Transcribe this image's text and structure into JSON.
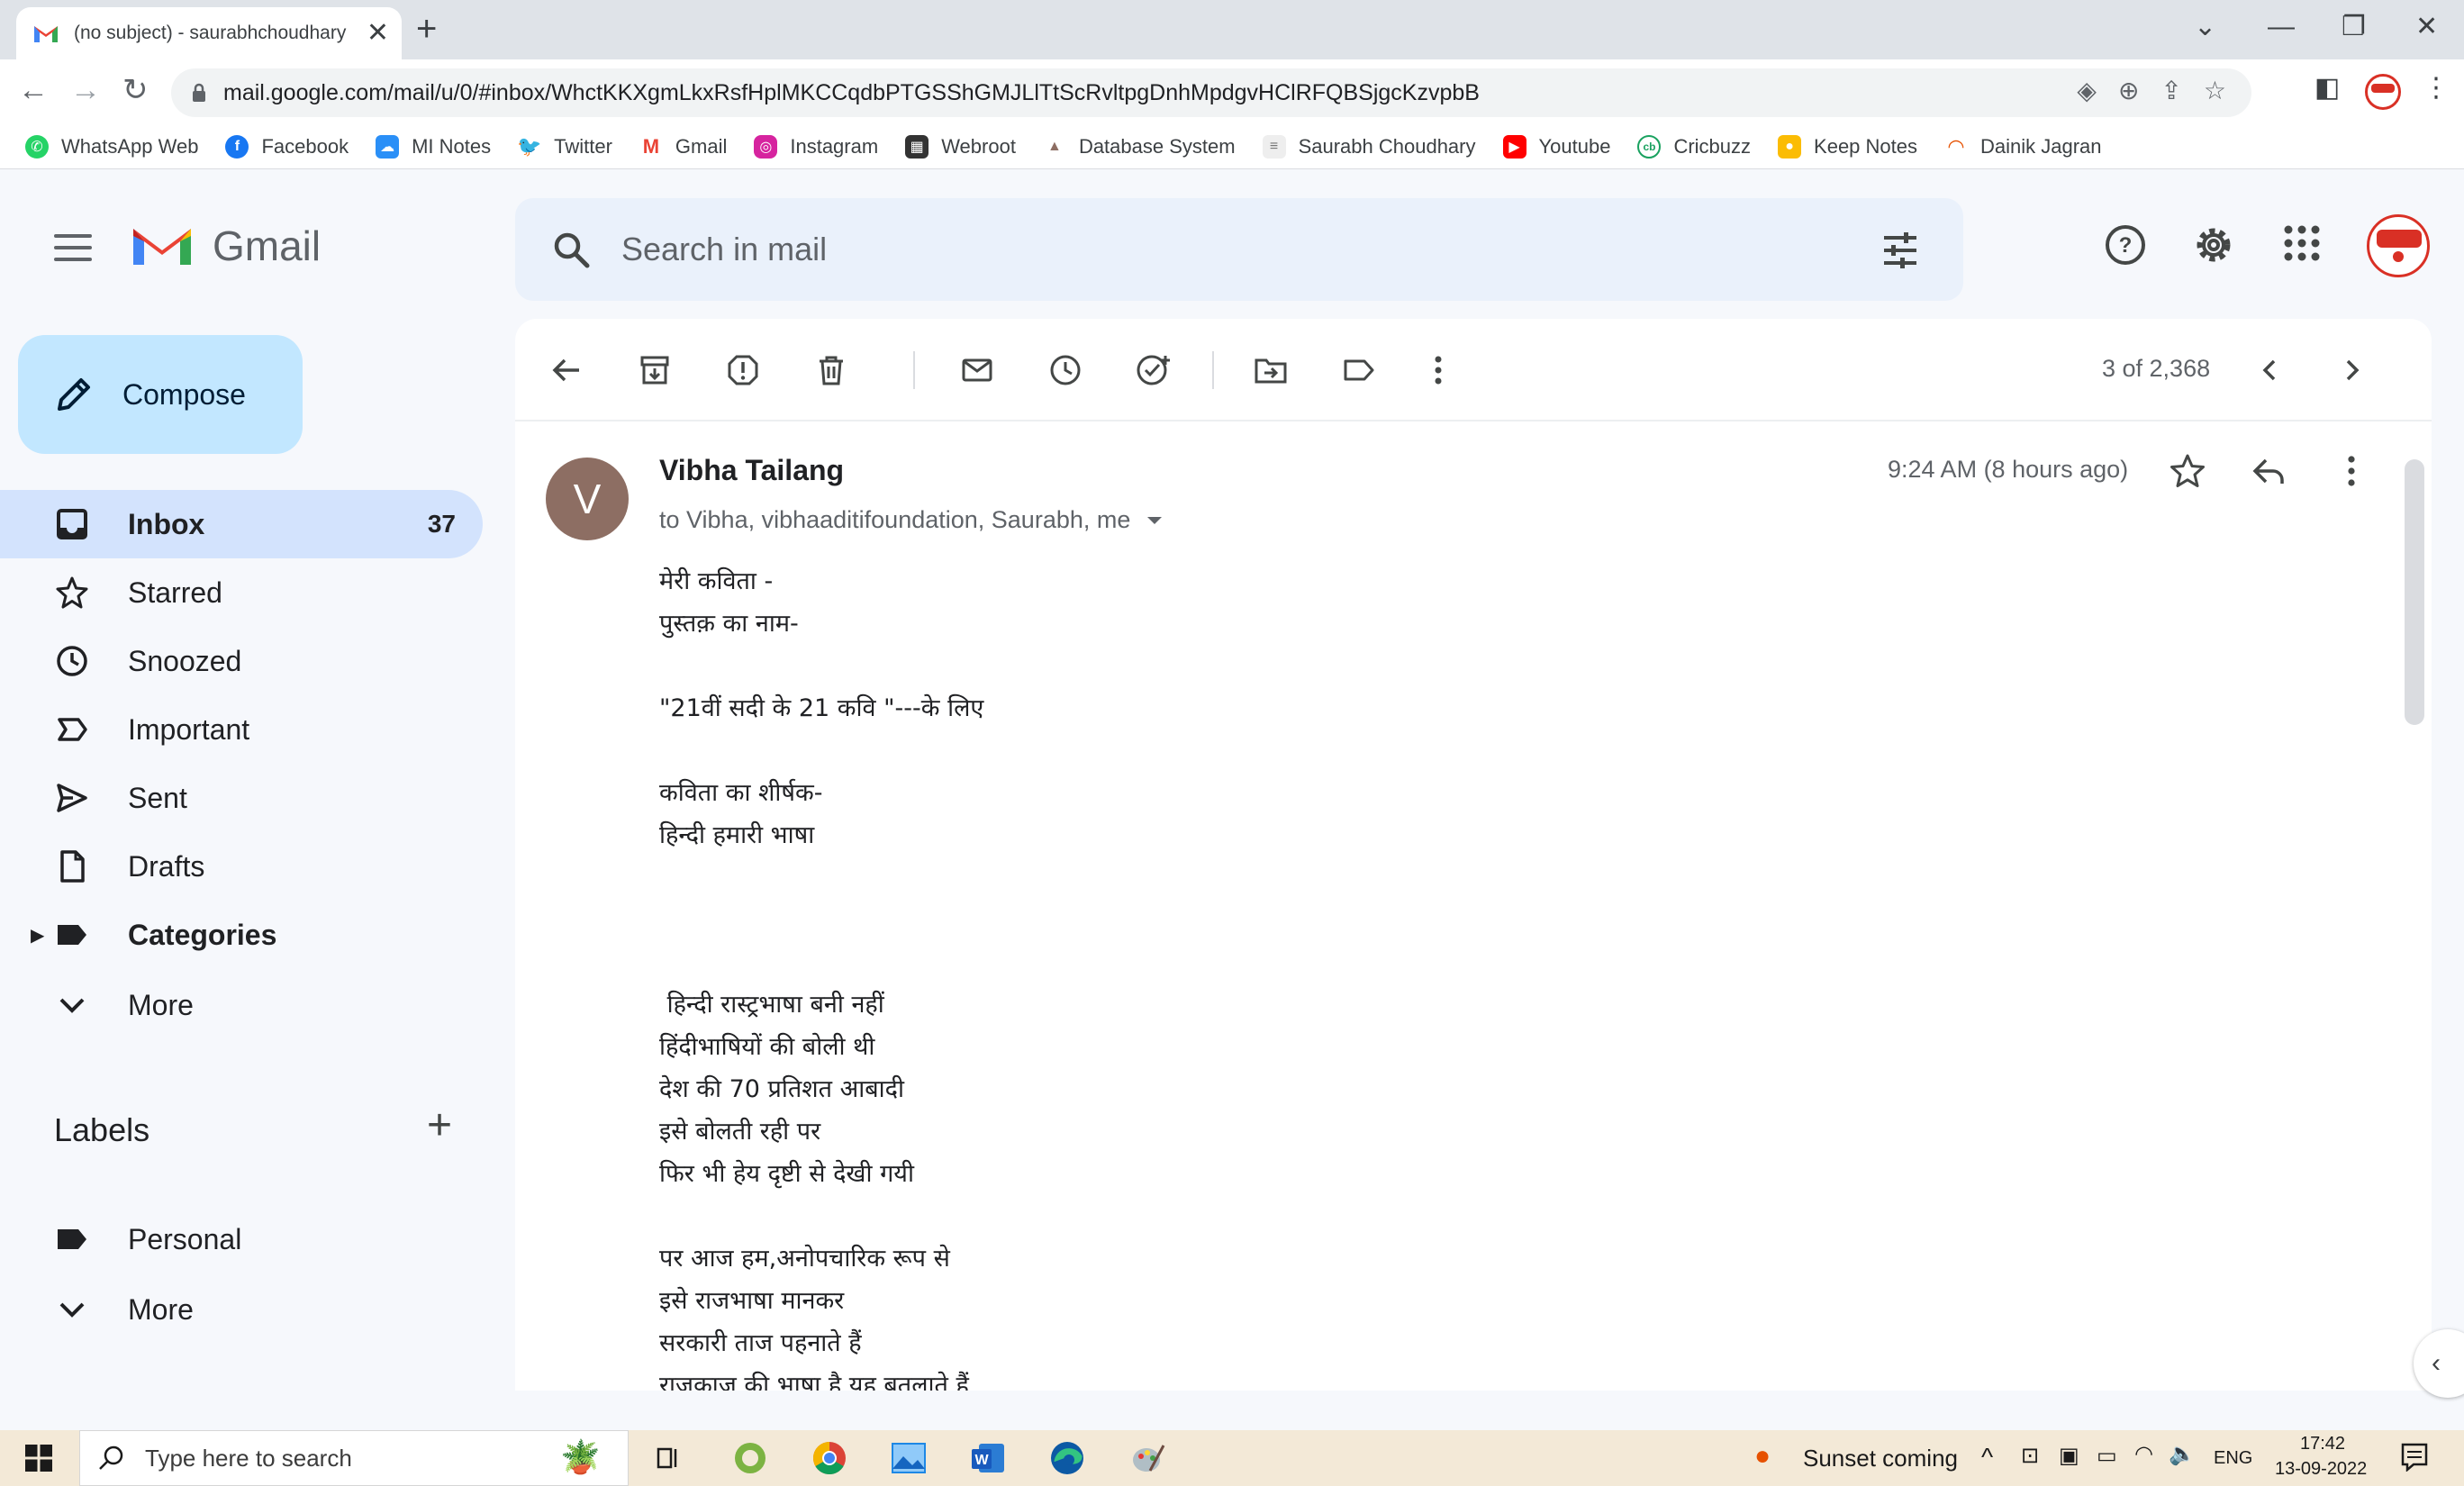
{
  "browser": {
    "tab_title": "(no subject) - saurabhchoudhary",
    "new_tab": "+",
    "url": "mail.google.com/mail/u/0/#inbox/WhctKKXgmLkxRsfHplMKCCqdbPTGSShGMJLlTtScRvltpgDnhMpdgvHClRFQBSjgcKzvpbB",
    "window_controls": {
      "minimize": "—",
      "maximize": "❐",
      "close": "✕",
      "tabsearch": "⌄"
    }
  },
  "bookmarks": [
    {
      "label": "WhatsApp Web",
      "color": "#25d366",
      "glyph": "✆"
    },
    {
      "label": "Facebook",
      "color": "#1877f2",
      "glyph": "f"
    },
    {
      "label": "MI Notes",
      "color": "#2a8ff7",
      "glyph": "☁"
    },
    {
      "label": "Twitter",
      "color": "#1d9bf0",
      "glyph": "t"
    },
    {
      "label": "Gmail",
      "color": "#ea4335",
      "glyph": "M"
    },
    {
      "label": "Instagram",
      "color": "#d6249f",
      "glyph": "◎"
    },
    {
      "label": "Webroot",
      "color": "#333333",
      "glyph": "▦"
    },
    {
      "label": "Database System",
      "color": "#8d6e63",
      "glyph": "▲"
    },
    {
      "label": "Saurabh Choudhary",
      "color": "#9e9e9e",
      "glyph": "≡"
    },
    {
      "label": "Youtube",
      "color": "#ff0000",
      "glyph": "▶"
    },
    {
      "label": "Cricbuzz",
      "color": "#1aa260",
      "glyph": "cb"
    },
    {
      "label": "Keep Notes",
      "color": "#fbbc04",
      "glyph": "●"
    },
    {
      "label": "Dainik Jagran",
      "color": "#e65100",
      "glyph": "◠"
    }
  ],
  "gmail": {
    "logo_text": "Gmail",
    "search_placeholder": "Search in mail",
    "compose_label": "Compose",
    "nav": [
      {
        "label": "Inbox",
        "count": "37",
        "icon": "inbox-icon",
        "active": true
      },
      {
        "label": "Starred",
        "icon": "star-icon"
      },
      {
        "label": "Snoozed",
        "icon": "clock-icon"
      },
      {
        "label": "Important",
        "icon": "important-icon"
      },
      {
        "label": "Sent",
        "icon": "send-icon"
      },
      {
        "label": "Drafts",
        "icon": "draft-icon"
      },
      {
        "label": "Categories",
        "icon": "label-icon"
      },
      {
        "label": "More",
        "icon": "chevron-down-icon"
      }
    ],
    "labels_heading": "Labels",
    "labels": [
      {
        "label": "Personal",
        "icon": "label-icon"
      },
      {
        "label": "More",
        "icon": "chevron-down-icon"
      }
    ]
  },
  "message": {
    "pager": "3 of 2,368",
    "avatar_letter": "V",
    "sender": "Vibha Tailang",
    "recipients": "to Vibha, vibhaaditifoundation, Saurabh, me",
    "time": "9:24 AM (8 hours ago)",
    "body_lines": [
      "मेरी कविता -",
      "पुस्तक़ का नाम-",
      "",
      "\"21वीं सदी के 21 कवि \"---के लिए",
      "",
      "कविता का शीर्षक-",
      "हिन्दी हमारी भाषा",
      "",
      "",
      "",
      " हिन्दी रास्ट्रभाषा बनी नहीं",
      "हिंदीभाषियों की बोली थी",
      "देश की 70 प्रतिशत आबादी",
      "इसे बोलती रही पर",
      "फिर भी हेय दृष्टी से देखी गयी",
      "",
      "पर आज हम,अनोपचारिक रूप से",
      "इसे राजभाषा मानकर",
      "सरकारी ताज पहनाते हैं",
      "राजकाज की भाषा है यह बतलाते हैं"
    ]
  },
  "taskbar": {
    "search_placeholder": "Type here to search",
    "weather": "Sunset coming",
    "language": "ENG",
    "time": "17:42",
    "date": "13-09-2022"
  }
}
